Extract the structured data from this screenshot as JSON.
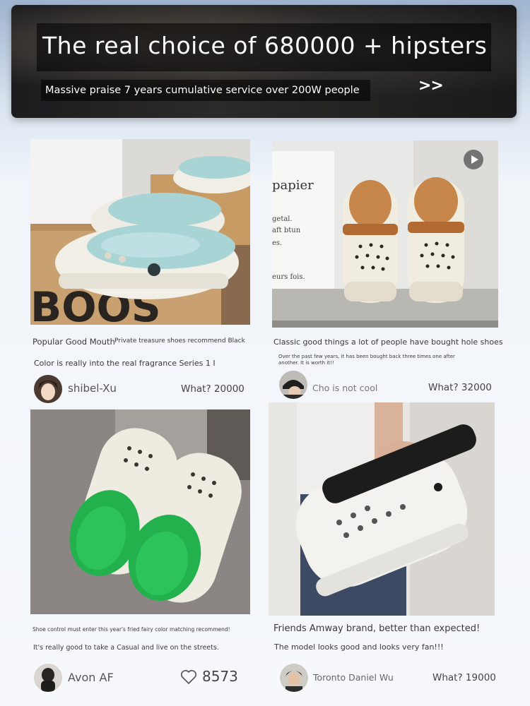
{
  "banner": {
    "title": "The real choice of 680000 + hipsters",
    "subtitle": "Massive praise 7 years cumulative service over 200W people",
    "arrow": ">>"
  },
  "cards": [
    {
      "line1_left": "Popular Good Mouth",
      "line1_right": "Private treasure shoes recommend Black",
      "line2": "Color is really into the real fragrance Series 1 I",
      "user": "shibel-Xu",
      "count": "What? 20000"
    },
    {
      "line1": "Classic good things a lot of people have bought hole shoes",
      "line2": "Over the past few years, it has been bought back three times one after another. It is worth it!!",
      "user": "Cho is not cool",
      "count": "What? 32000",
      "box_text": [
        "papier",
        "getal.",
        "aft btun",
        "es.",
        "eurs fois."
      ]
    },
    {
      "line1": "Shoe control must enter this year's fried fairy color matching recommend!",
      "line2": "It's really good to take a Casual and live on the streets.",
      "user": "Avon AF",
      "likes": "8573"
    },
    {
      "line1": "Friends Amway brand, better than expected!",
      "line2": "The model looks good and looks very fan!!!",
      "user": "Toronto Daniel Wu",
      "count": "What? 19000"
    }
  ],
  "colors": {
    "banner_bg": "#1e1e1f",
    "accent_green": "#22b14c",
    "accent_blue": "#a8d4d6",
    "accent_brown": "#b06a32",
    "shoe_white": "#f2efe6"
  },
  "icons": [
    "play-icon",
    "heart-icon",
    "double-chevron-right-icon"
  ]
}
